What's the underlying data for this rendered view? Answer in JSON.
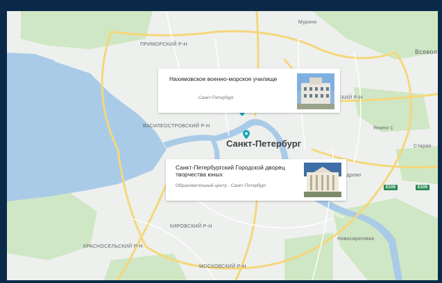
{
  "map": {
    "colors": {
      "water": "#a9cbe8",
      "land": "#eef0ee",
      "park": "#cfe7c4",
      "road_major": "#fbe6a2",
      "road_minor": "#ffffff",
      "frame": "#0b2a4a",
      "pin": "#1aa3b8"
    },
    "labels": {
      "murino": "Мурино",
      "primorsky": "ПРИМОРСКИЙ Р-Н",
      "vsevolozhsk": "Всевол",
      "district_right": "СКИЙ Р-Н",
      "vasileostrovsky": "ВАСИЛЕОСТРОВСКИЙ Р-Н",
      "yanino": "Янино-1",
      "staraya": "Старая",
      "kudrovo": "удрово",
      "kirovsky": "КИРОВСКИЙ Р-Н",
      "novosaratovka": "Новосаратовка",
      "krasnoselsky": "КРАСНОСЕЛЬСКИЙ Р-Н",
      "moskovsky": "МОСКОВСКИЙ Р-Н",
      "neva": "Нева",
      "city": "Санкт-Петербург"
    },
    "shields": [
      "E105",
      "E105"
    ]
  },
  "cards": [
    {
      "title": "Нахимовское военно-морское училище",
      "subtitle": "Санкт-Петербург",
      "image_icon": "building-photo-icon"
    },
    {
      "title": "Санкт-Петербургский Городской дворец творчества юных",
      "subtitle": "Образовательный центр · Санкт-Петербург",
      "image_icon": "palace-photo-icon"
    }
  ],
  "pins": [
    "location-pin-icon",
    "location-pin-icon"
  ]
}
